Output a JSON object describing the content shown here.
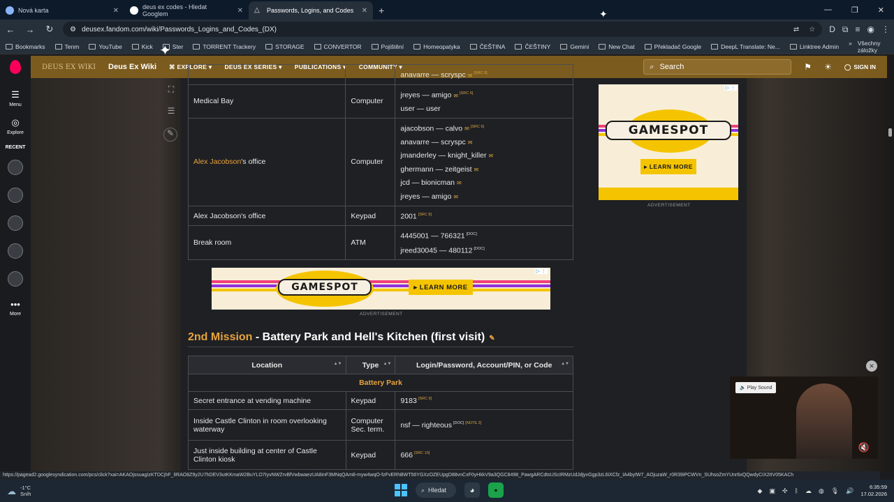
{
  "browser": {
    "tabs": [
      {
        "title": "Nová karta",
        "close": "✕"
      },
      {
        "title": "deus ex codes - Hledat Googlem",
        "close": "✕"
      },
      {
        "title": "Passwords, Logins, and Codes",
        "close": "✕"
      }
    ],
    "new_tab": "+",
    "url": "deusex.fandom.com/wiki/Passwords_Logins_and_Codes_(DX)",
    "profile_letter": "D",
    "bookmarks": [
      "Bookmarks",
      "Tenm",
      "YouTube",
      "Kick",
      "Ster",
      "TORRENT Trackery",
      "STORAGE",
      "CONVERTOR",
      "Pojištění",
      "Homeopatyka",
      "ČEŠTINA",
      "ČEŠTINY",
      "Gemini",
      "New Chat",
      "Překladač Google",
      "DeepL Translate: Ne...",
      "Linktree Admin"
    ],
    "all_bookmarks": "Všechny záložky"
  },
  "fandom": {
    "wiki_logo": "DEUS EX WIKI",
    "wiki_name": "Deus Ex Wiki",
    "nav": [
      "EXPLORE",
      "DEUS EX SERIES",
      "PUBLICATIONS",
      "COMMUNITY"
    ],
    "search_placeholder": "Search",
    "sign_in": "SIGN IN",
    "rail": {
      "menu": "Menu",
      "explore": "Explore",
      "recent": "RECENT",
      "more": "More"
    }
  },
  "table1": {
    "rows": [
      {
        "location": "",
        "type": "",
        "logins": [
          {
            "text": "anavarre — scryspc",
            "mail": true,
            "note": "[SRC 6]"
          }
        ]
      },
      {
        "location": "Medical Bay",
        "type": "Computer",
        "logins": [
          {
            "text": "jreyes — amigo",
            "mail": true,
            "note": "[SRC 6]"
          },
          {
            "text": "user — user",
            "mail": false,
            "note": ""
          }
        ]
      },
      {
        "location_link": "Alex Jacobson",
        "location_suffix": "'s office",
        "type": "Computer",
        "logins": [
          {
            "text": "ajacobson — calvo",
            "mail": true,
            "note": "[SRC 6]"
          },
          {
            "text": "anavarre — scryspc",
            "mail": true,
            "note": ""
          },
          {
            "text": "jmanderley — knight_killer",
            "mail": true,
            "note": ""
          },
          {
            "text": "ghermann — zeitgeist",
            "mail": true,
            "note": ""
          },
          {
            "text": "jcd — bionicman",
            "mail": true,
            "note": ""
          },
          {
            "text": "jreyes — amigo",
            "mail": true,
            "note": ""
          }
        ]
      },
      {
        "location": "Alex Jacobson's office",
        "type": "Keypad",
        "logins": [
          {
            "text": "2001",
            "mail": false,
            "note": "[SRC 8]"
          }
        ]
      },
      {
        "location": "Break room",
        "type": "ATM",
        "logins": [
          {
            "text": "4445001 — 766321",
            "mail": false,
            "note": "[DOC]"
          },
          {
            "text": "jreed30045 — 480112",
            "mail": false,
            "note": "[DOC]"
          }
        ]
      }
    ]
  },
  "ads": {
    "brand": "GAMESPOT",
    "cta": "▸ LEARN MORE",
    "label": "ADVERTISEMENT",
    "choices": "▷ ⋮"
  },
  "section": {
    "mission_link": "2nd Mission",
    "title_rest": " - Battery Park and Hell's Kitchen (first visit)"
  },
  "table2": {
    "headers": [
      "Location",
      "Type",
      "Login/Password, Account/PIN, or Code"
    ],
    "group": "Battery Park",
    "rows": [
      {
        "location": "Secret entrance at vending machine",
        "type": "Keypad",
        "code": "9183",
        "notes": [
          "[SRC 9]"
        ]
      },
      {
        "location": "Inside Castle Clinton in room overlooking waterway",
        "type": "Computer Sec. term.",
        "code": "nsf — righteous",
        "notes": [
          "[DOC]",
          "[NOTE 2]"
        ]
      },
      {
        "location": "Just inside building at center of Castle Clinton kiosk",
        "type": "Keypad",
        "code": "666",
        "notes": [
          "[SRC 10]"
        ]
      }
    ]
  },
  "video": {
    "play_sound": "Play Sound"
  },
  "status_url": "https://pagead2.googlesyndication.com/pcs/click?xai=AKAOjssuagIzKTDCjhF_lIRAO8Z9y2U7hDEV3utKKmaW2BuYLO7IyvNWZrvBfVwbwaezUA8inF3MNqQAm8-myw4wqO-fzFvERhBWT56YGXzOZEUpgD88vnCxF0yHkkV9a3QGC8498_PawgARCdtsUScIRMzUdJdjyvGgp3zL6iXCfz_IA4byIW7_AOjuzaW_r0R39iPCWVn_SUhsoZmYUnr6xQQwdyCIX2tIV05KACh",
  "taskbar": {
    "temp": "-1°C",
    "weather": "Sníh",
    "search": "Hledat",
    "time": "6:35:59",
    "date": "17.02.2026"
  },
  "colors": {
    "fandom_nav": "#7b5b1e",
    "link": "#e8a33d",
    "accent_ad": "#f5c400"
  }
}
